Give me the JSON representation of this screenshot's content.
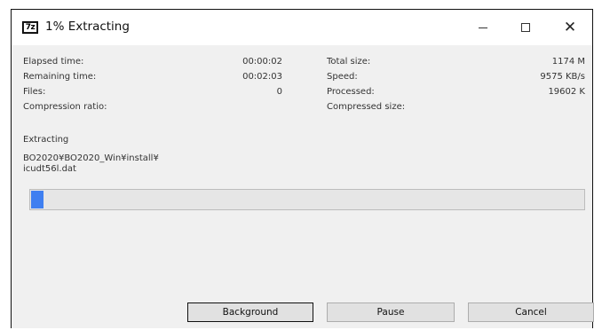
{
  "window": {
    "title": "1% Extracting",
    "icon_label": "7z"
  },
  "stats_left": [
    {
      "label": "Elapsed time:",
      "value": "00:00:02"
    },
    {
      "label": "Remaining time:",
      "value": "00:02:03"
    },
    {
      "label": "Files:",
      "value": "0"
    },
    {
      "label": "Compression ratio:",
      "value": ""
    }
  ],
  "stats_right": [
    {
      "label": "Total size:",
      "value": "1174 M"
    },
    {
      "label": "Speed:",
      "value": "9575 KB/s"
    },
    {
      "label": "Processed:",
      "value": "19602 K"
    },
    {
      "label": "Compressed size:",
      "value": ""
    }
  ],
  "operation": {
    "label": "Extracting",
    "path_line1": "BO2020¥BO2020_Win¥install¥",
    "path_line2": "icudt56l.dat"
  },
  "progress": {
    "fraction": 0.01,
    "color": "#3f7ff0"
  },
  "buttons": {
    "background": "Background",
    "pause": "Pause",
    "cancel": "Cancel"
  }
}
